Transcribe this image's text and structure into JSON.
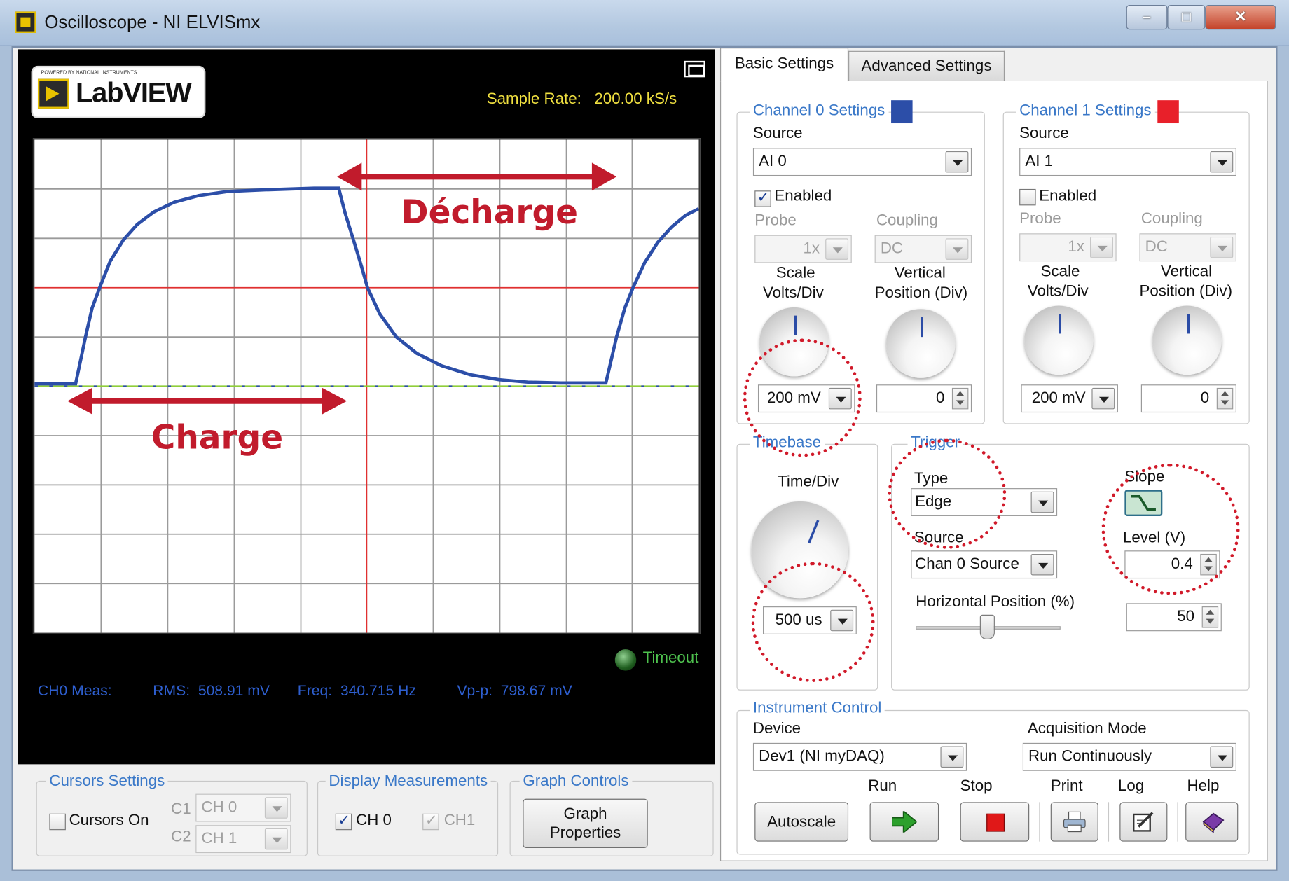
{
  "window": {
    "title": "Oscilloscope - NI ELVISmx"
  },
  "scope": {
    "logo_text": "LabVIEW",
    "logo_powered": "POWERED BY NATIONAL INSTRUMENTS",
    "sample_rate_label": "Sample Rate:",
    "sample_rate_value": "200.00 kS/s",
    "timeout_label": "Timeout",
    "annotation_charge": "Charge",
    "annotation_decharge": "Décharge",
    "measurements": {
      "label": "CH0 Meas:",
      "rms": "RMS:  508.91 mV",
      "freq": "Freq:  340.715 Hz",
      "vpp": "Vp-p:  798.67 mV"
    }
  },
  "cursors": {
    "group_label": "Cursors Settings",
    "cursors_on_label": "Cursors On",
    "cursors_on_checked": false,
    "c1_label": "C1",
    "c1_value": "CH 0",
    "c2_label": "C2",
    "c2_value": "CH 1"
  },
  "display_measurements": {
    "group_label": "Display Measurements",
    "ch0_label": "CH 0",
    "ch0_checked": true,
    "ch1_label": "CH1",
    "ch1_checked": true
  },
  "graph_controls": {
    "group_label": "Graph Controls",
    "button_line1": "Graph",
    "button_line2": "Properties"
  },
  "tabs": [
    {
      "label": "Basic Settings",
      "active": true
    },
    {
      "label": "Advanced Settings",
      "active": false
    }
  ],
  "channel0": {
    "group_label": "Channel 0 Settings",
    "color": "#2c4ea8",
    "source_label": "Source",
    "source_value": "AI 0",
    "enabled_label": "Enabled",
    "enabled_checked": true,
    "probe_label": "Probe",
    "probe_value": "1x",
    "coupling_label": "Coupling",
    "coupling_value": "DC",
    "scale_label_1": "Scale",
    "scale_label_2": "Volts/Div",
    "vpos_label_1": "Vertical",
    "vpos_label_2": "Position (Div)",
    "scale_value": "200 mV",
    "vpos_value": "0"
  },
  "channel1": {
    "group_label": "Channel 1 Settings",
    "color": "#e8202a",
    "source_label": "Source",
    "source_value": "AI 1",
    "enabled_label": "Enabled",
    "enabled_checked": false,
    "probe_label": "Probe",
    "probe_value": "1x",
    "coupling_label": "Coupling",
    "coupling_value": "DC",
    "scale_label_1": "Scale",
    "scale_label_2": "Volts/Div",
    "vpos_label_1": "Vertical",
    "vpos_label_2": "Position (Div)",
    "scale_value": "200 mV",
    "vpos_value": "0"
  },
  "timebase": {
    "group_label": "Timebase",
    "time_div_label": "Time/Div",
    "time_div_value": "500 us"
  },
  "trigger": {
    "group_label": "Trigger",
    "type_label": "Type",
    "type_value": "Edge",
    "source_label": "Source",
    "source_value": "Chan 0 Source",
    "hpos_label": "Horizontal Position (%)",
    "hpos_value": "50",
    "slope_label": "Slope",
    "level_label": "Level (V)",
    "level_value": "0.4"
  },
  "instrument": {
    "group_label": "Instrument Control",
    "device_label": "Device",
    "device_value": "Dev1 (NI myDAQ)",
    "acq_label": "Acquisition Mode",
    "acq_value": "Run Continuously",
    "autoscale_label": "Autoscale",
    "run_label": "Run",
    "stop_label": "Stop",
    "print_label": "Print",
    "log_label": "Log",
    "help_label": "Help"
  },
  "colors": {
    "trace": "#2c4ea8",
    "annotation": "#c11b2c",
    "trigger_line": "#e03030",
    "baseline": "#8fce3a",
    "group_label": "#3a78c8",
    "sample_rate_text": "#f0e040",
    "measurement_text": "#2e5fd0"
  }
}
